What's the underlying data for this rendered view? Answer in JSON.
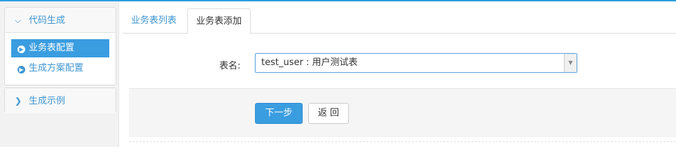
{
  "sidebar": {
    "group1": {
      "label": "代码生成",
      "icon": "chevron-down-icon"
    },
    "items": [
      {
        "label": "业务表配置",
        "icon": "circle-arrow-right-icon",
        "active": true
      },
      {
        "label": "生成方案配置",
        "icon": "circle-arrow-right-icon",
        "active": false
      }
    ],
    "group2": {
      "label": "生成示例",
      "icon": "chevron-right-icon"
    }
  },
  "tabs": [
    {
      "label": "业务表列表",
      "active": false
    },
    {
      "label": "业务表添加",
      "active": true
    }
  ],
  "form": {
    "table_label": "表名:",
    "table_value": "test_user : 用户测试表"
  },
  "actions": {
    "next_label": "下一步",
    "back_label": "返 回"
  },
  "colors": {
    "accent": "#3a9de0",
    "link": "#3f96d2",
    "top_bar": "#2e9fe0"
  }
}
